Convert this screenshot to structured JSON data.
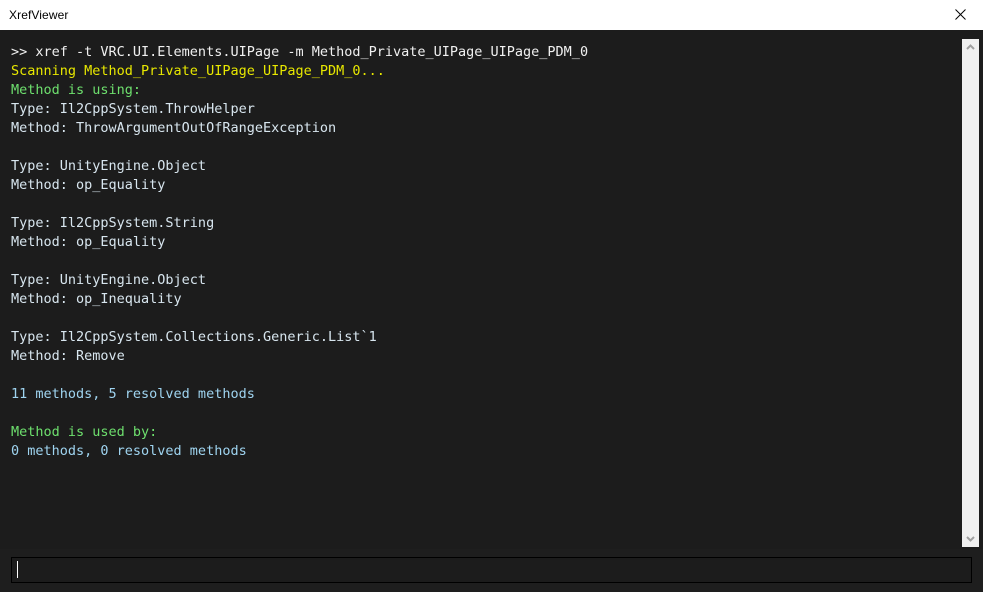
{
  "window": {
    "title": "XrefViewer",
    "close_label": "✕",
    "close_icon": "close-icon"
  },
  "console": {
    "lines": [
      {
        "text": ">> xref -t VRC.UI.Elements.UIPage -m Method_Private_UIPage_UIPage_PDM_0",
        "color": "white"
      },
      {
        "text": "Scanning Method_Private_UIPage_UIPage_PDM_0...",
        "color": "yellow"
      },
      {
        "text": "Method is using:",
        "color": "green"
      },
      {
        "text": "Type: Il2CppSystem.ThrowHelper",
        "color": "label"
      },
      {
        "text": "Method: ThrowArgumentOutOfRangeException",
        "color": "label"
      },
      {
        "text": "",
        "color": "white"
      },
      {
        "text": "Type: UnityEngine.Object",
        "color": "label"
      },
      {
        "text": "Method: op_Equality",
        "color": "label"
      },
      {
        "text": "",
        "color": "white"
      },
      {
        "text": "Type: Il2CppSystem.String",
        "color": "label"
      },
      {
        "text": "Method: op_Equality",
        "color": "label"
      },
      {
        "text": "",
        "color": "white"
      },
      {
        "text": "Type: UnityEngine.Object",
        "color": "label"
      },
      {
        "text": "Method: op_Inequality",
        "color": "label"
      },
      {
        "text": "",
        "color": "white"
      },
      {
        "text": "Type: Il2CppSystem.Collections.Generic.List`1",
        "color": "label"
      },
      {
        "text": "Method: Remove",
        "color": "label"
      },
      {
        "text": "",
        "color": "white"
      },
      {
        "text": "11 methods, 5 resolved methods",
        "color": "cyan"
      },
      {
        "text": "",
        "color": "white"
      },
      {
        "text": "Method is used by:",
        "color": "green"
      },
      {
        "text": "0 methods, 0 resolved methods",
        "color": "cyan"
      }
    ]
  },
  "scrollbar": {
    "up_icon": "chevron-up-icon",
    "down_icon": "chevron-down-icon"
  },
  "command_input": {
    "value": "",
    "placeholder": ""
  },
  "colors": {
    "background": "#1e1e1e",
    "console_background": "#1c1c1c",
    "titlebar": "#ffffff",
    "text_white": "#f0f0f0",
    "text_yellow": "#e8e800",
    "text_green": "#6ee06e",
    "text_cyan": "#9fd4f0",
    "scrollbar": "#f0f0f0"
  }
}
